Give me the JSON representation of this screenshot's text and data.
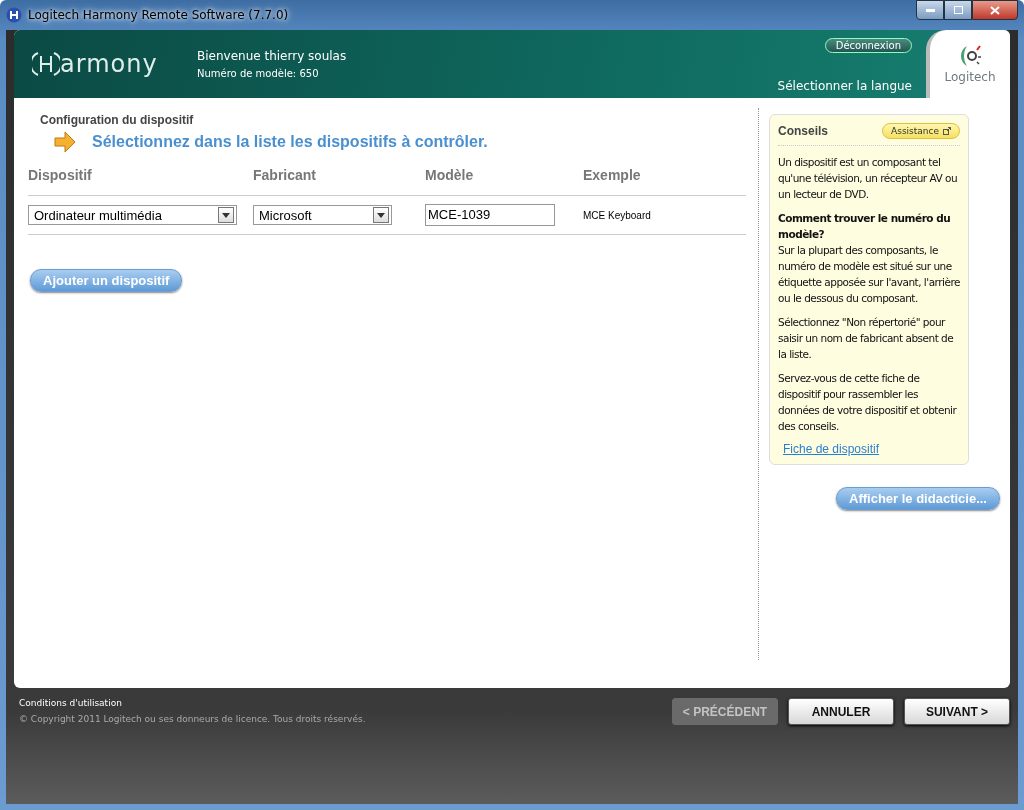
{
  "window": {
    "title": "Logitech Harmony Remote Software (7.7.0)"
  },
  "header": {
    "brand": "armony",
    "welcome": "Bienvenue thierry soulas",
    "model_number": "Numéro de modèle: 650",
    "logout": "Déconnexion",
    "language": "Sélectionner la langue",
    "logo_text": "Logitech"
  },
  "section": {
    "title": "Configuration du dispositif",
    "instruction": "Sélectionnez dans la liste les dispositifs à contrôler."
  },
  "table": {
    "columns": [
      "Dispositif",
      "Fabricant",
      "Modèle",
      "Exemple"
    ],
    "rows": [
      {
        "device": "Ordinateur multimédia",
        "manufacturer": "Microsoft",
        "model": "MCE-1039",
        "example": "MCE Keyboard"
      }
    ]
  },
  "add_button": "Ajouter un dispositif",
  "tips": {
    "title": "Conseils",
    "assistance": "Assistance",
    "paragraphs": [
      {
        "kind": "text",
        "text": "Un dispositif est un composant tel qu'une télévision, un récepteur AV ou un lecteur de DVD."
      },
      {
        "kind": "heading",
        "text": "Comment trouver le numéro du modèle?"
      },
      {
        "kind": "text",
        "text": "Sur la plupart des composants, le numéro de modèle est situé sur une étiquette apposée sur l'avant, l'arrière ou le dessous du composant."
      },
      {
        "kind": "text",
        "text": "Sélectionnez \"Non répertorié\" pour saisir un nom de fabricant absent de la liste."
      },
      {
        "kind": "text",
        "text": "Servez-vous de cette fiche de dispositif pour rassembler les données de votre dispositif et obtenir des conseils."
      }
    ],
    "link": "Fiche de dispositif"
  },
  "tutorial_button": "Afficher le didacticie...",
  "footer": {
    "terms": "Conditions d'utilisation",
    "copyright": "© Copyright 2011 Logitech ou ses donneurs de licence. Tous droits réservés.",
    "buttons": [
      {
        "label": "< PRÉCÉDENT",
        "disabled": true
      },
      {
        "label": "ANNULER",
        "disabled": false
      },
      {
        "label": "SUIVANT >",
        "disabled": false
      }
    ]
  }
}
